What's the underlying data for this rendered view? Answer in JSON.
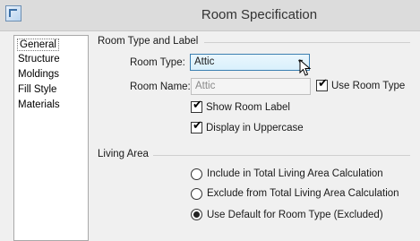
{
  "window": {
    "title": "Room Specification",
    "icon": "app-icon"
  },
  "sidebar": {
    "items": [
      {
        "label": "General",
        "selected": true
      },
      {
        "label": "Structure"
      },
      {
        "label": "Moldings"
      },
      {
        "label": "Fill Style"
      },
      {
        "label": "Materials"
      }
    ]
  },
  "room_type_group": {
    "title": "Room Type and Label",
    "room_type_label": "Room Type:",
    "room_type_value": "Attic",
    "room_name_label": "Room Name:",
    "room_name_placeholder": "Attic",
    "use_room_type_label": "Use Room Type",
    "use_room_type_checked": true,
    "show_room_label": "Show Room Label",
    "show_room_label_checked": true,
    "display_uppercase_label": "Display in Uppercase",
    "display_uppercase_checked": true
  },
  "living_area_group": {
    "title": "Living Area",
    "options": [
      {
        "label": "Include in Total Living Area Calculation",
        "selected": false
      },
      {
        "label": "Exclude from Total Living Area Calculation",
        "selected": false
      },
      {
        "label": "Use Default for Room Type (Excluded)",
        "selected": true
      }
    ]
  }
}
